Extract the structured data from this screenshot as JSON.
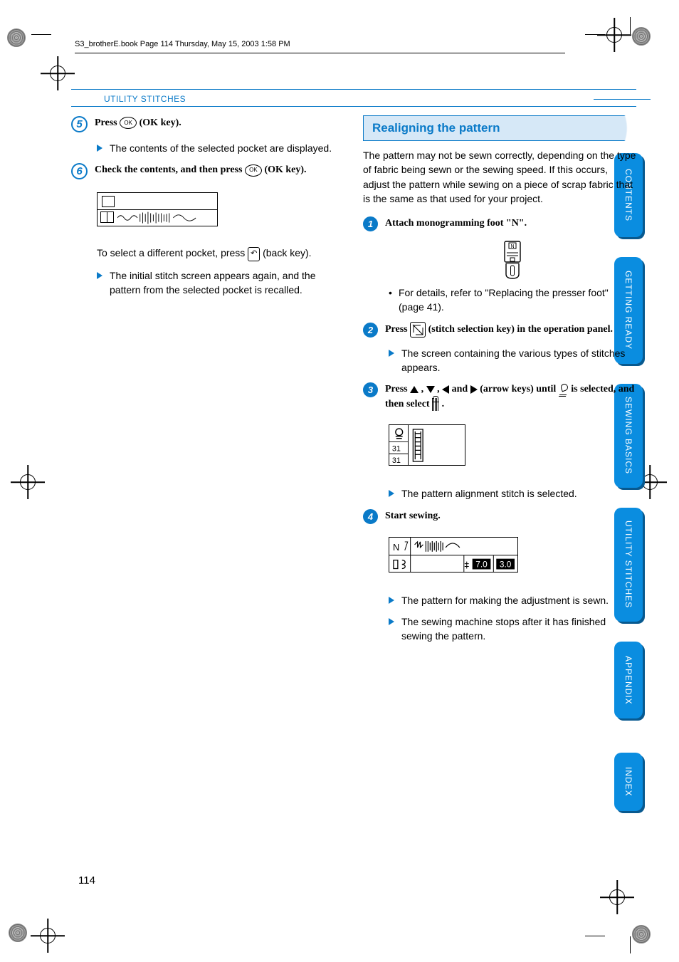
{
  "doc_header": "S3_brotherE.book  Page 114  Thursday, May 15, 2003  1:58 PM",
  "section_header": "UTILITY STITCHES",
  "page_number": "114",
  "side_tabs": [
    "CONTENTS",
    "GETTING READY",
    "SEWING BASICS",
    "UTILITY STITCHES",
    "APPENDIX",
    "INDEX"
  ],
  "left": {
    "step5": {
      "num": "5",
      "title_pre": "Press ",
      "ok_label": "OK",
      "title_post": " (OK key).",
      "sub1": "The contents of the selected pocket are displayed."
    },
    "step6": {
      "num": "6",
      "title_pre": "Check the contents, and then press ",
      "ok_label": "OK",
      "title_post": " (OK key).",
      "para1_pre": "To select a different pocket, press ",
      "back_glyph": "↶",
      "para1_post": " (back key).",
      "sub1": "The initial stitch screen appears again, and the pattern from the selected pocket is recalled."
    }
  },
  "right": {
    "heading": "Realigning the pattern",
    "intro": "The pattern may not be sewn correctly, depending on the type of fabric being sewn or the sewing speed. If this occurs, adjust the pattern while sewing on a piece of scrap fabric that is the same as that used for your project.",
    "step1": {
      "num": "1",
      "title": "Attach monogramming foot \"N\".",
      "foot_label": "N",
      "bullet": "For details, refer to \"Replacing the presser foot\" (page 41)."
    },
    "step2": {
      "num": "2",
      "title_pre": "Press ",
      "title_post": " (stitch selection key) in the operation panel.",
      "sub1": "The screen containing the various types of stitches appears."
    },
    "step3": {
      "num": "3",
      "title_pre": "Press ",
      "title_mid1": " , ",
      "title_mid2": " , ",
      "title_mid3": " and ",
      "title_mid4": " (arrow keys) until ",
      "title_mid5": " is selected, and then select ",
      "title_end": " .",
      "lcd_num1": "31",
      "lcd_num2": "31",
      "sub1": "The pattern alignment stitch is selected."
    },
    "step4": {
      "num": "4",
      "title": "Start sewing.",
      "lcd_left": "N",
      "lcd_v1": "7.0",
      "lcd_v2": "3.0",
      "sub1": "The pattern for making the adjustment is sewn.",
      "sub2": "The sewing machine stops after it has finished sewing the pattern."
    }
  }
}
